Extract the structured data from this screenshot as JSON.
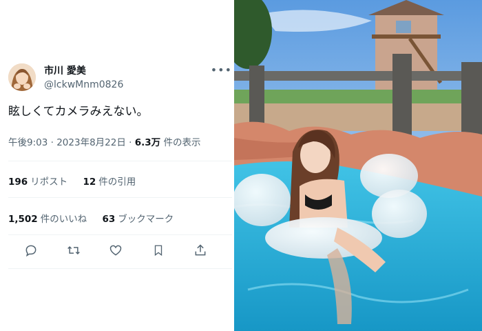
{
  "tweet": {
    "display_name": "市川 愛美",
    "handle": "@lckwMnm0826",
    "more_label": "•••",
    "text": "眩しくてカメラみえない。",
    "time": "午後9:03",
    "date": "2023年8月22日",
    "views_count": "6.3万",
    "views_label": "件の表示",
    "separator": "·"
  },
  "stats": {
    "reposts_count": "196",
    "reposts_label": "リポスト",
    "quotes_count": "12",
    "quotes_label": "件の引用",
    "likes_count": "1,502",
    "likes_label": "件のいいね",
    "bookmarks_count": "63",
    "bookmarks_label": "ブックマーク"
  },
  "actions": [
    "reply-icon",
    "repost-icon",
    "like-icon",
    "bookmark-icon",
    "share-icon"
  ],
  "colors": {
    "text": "#0f1419",
    "secondary": "#536471",
    "divider": "#eff3f4",
    "pool": "#2fb3d6"
  }
}
